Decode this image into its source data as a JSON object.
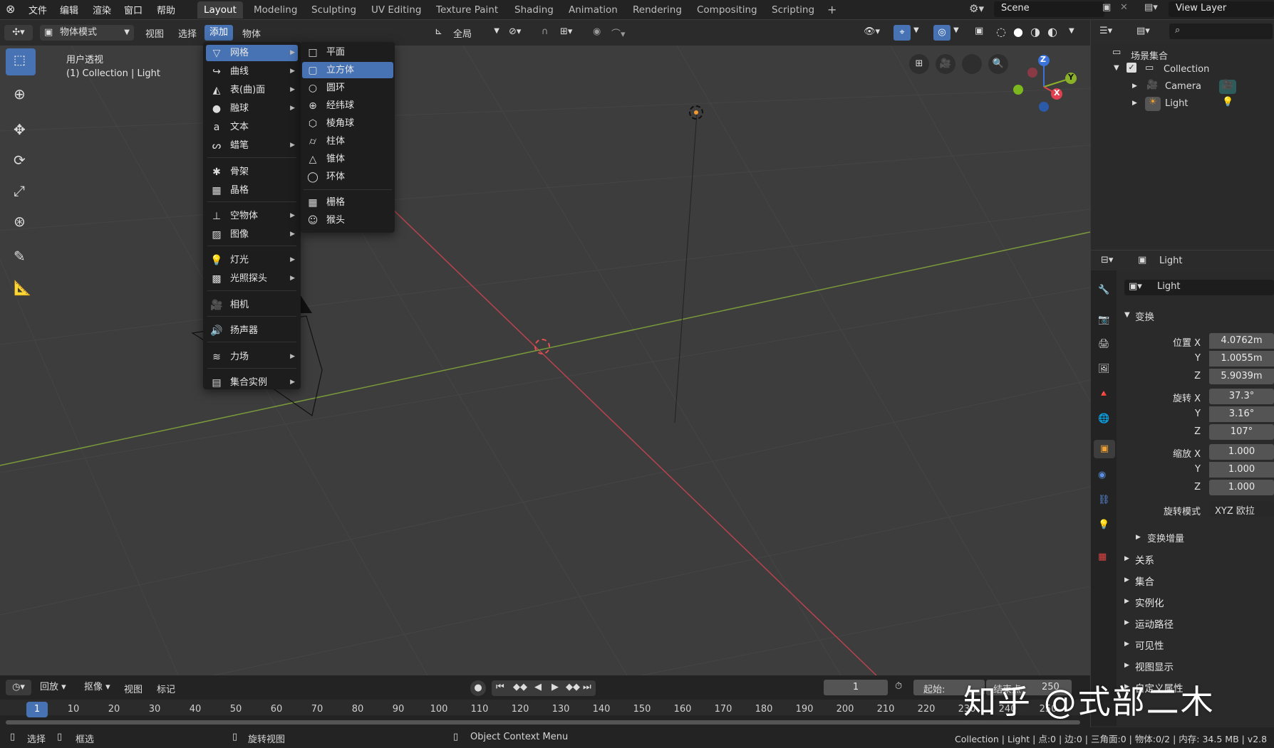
{
  "topbar": {
    "menus": [
      "文件",
      "编辑",
      "渲染",
      "窗口",
      "帮助"
    ],
    "workspaces": [
      "Layout",
      "Modeling",
      "Sculpting",
      "UV Editing",
      "Texture Paint",
      "Shading",
      "Animation",
      "Rendering",
      "Compositing",
      "Scripting"
    ],
    "active_workspace": "Layout",
    "add_tab": "+",
    "scene": "Scene",
    "view_layer": "View Layer"
  },
  "viewport_header": {
    "mode": "物体模式",
    "menus": [
      "视图",
      "选择",
      "添加",
      "物体"
    ],
    "orientation": "全局"
  },
  "viewport": {
    "view_name": "用户透视",
    "context": "(1) Collection | Light",
    "gizmo": {
      "z": "Z",
      "y": "Y",
      "x": "X"
    }
  },
  "add_menu": {
    "items": [
      {
        "icon": "mesh-icon",
        "label": "网格",
        "submenu": true
      },
      {
        "icon": "curve-icon",
        "label": "曲线",
        "submenu": true
      },
      {
        "icon": "surface-icon",
        "label": "表(曲)面",
        "submenu": true
      },
      {
        "icon": "metaball-icon",
        "label": "融球",
        "submenu": true
      },
      {
        "icon": "text-icon",
        "label": "文本",
        "submenu": false
      },
      {
        "icon": "grease-pencil-icon",
        "label": "蜡笔",
        "submenu": true
      },
      {
        "icon": "armature-icon",
        "label": "骨架",
        "submenu": false
      },
      {
        "icon": "lattice-icon",
        "label": "晶格",
        "submenu": false
      },
      {
        "icon": "empty-icon",
        "label": "空物体",
        "submenu": true
      },
      {
        "icon": "image-icon",
        "label": "图像",
        "submenu": true
      },
      {
        "icon": "light-icon",
        "label": "灯光",
        "submenu": true
      },
      {
        "icon": "light-probe-icon",
        "label": "光照探头",
        "submenu": true
      },
      {
        "icon": "camera-icon",
        "label": "相机",
        "submenu": false
      },
      {
        "icon": "speaker-icon",
        "label": "扬声器",
        "submenu": false
      },
      {
        "icon": "force-field-icon",
        "label": "力场",
        "submenu": true
      },
      {
        "icon": "collection-instance-icon",
        "label": "集合实例",
        "submenu": true
      }
    ],
    "active_index": 0
  },
  "mesh_submenu": {
    "items": [
      "平面",
      "立方体",
      "圆环",
      "经纬球",
      "棱角球",
      "柱体",
      "锥体",
      "环体",
      "栅格",
      "猴头"
    ],
    "highlight_index": 1
  },
  "outliner": {
    "root": "场景集合",
    "collection": "Collection",
    "children": [
      "Camera",
      "Light"
    ]
  },
  "properties": {
    "object_name": "Light",
    "object_field": "Light",
    "section_transform": "变换",
    "location_label": "位置 X",
    "y_label": "Y",
    "z_label": "Z",
    "location": [
      "4.0762m",
      "1.0055m",
      "5.9039m"
    ],
    "rotation_label": "旋转 X",
    "rotation": [
      "37.3°",
      "3.16°",
      "107°"
    ],
    "scale_label": "缩放 X",
    "scale": [
      "1.000",
      "1.000",
      "1.000"
    ],
    "rotation_mode_label": "旋转模式",
    "rotation_mode": "XYZ 欧拉",
    "delta": "变换增量",
    "sections": [
      "关系",
      "集合",
      "实例化",
      "运动路径",
      "可见性",
      "视图显示",
      "自定义属性"
    ]
  },
  "timeline": {
    "menus": [
      "回放",
      "抠像",
      "视图",
      "标记"
    ],
    "current_frame": "1",
    "start_label": "起始:",
    "end_label": "结束点",
    "end_value": "250",
    "ticks": [
      "1",
      "10",
      "20",
      "30",
      "40",
      "50",
      "60",
      "70",
      "80",
      "90",
      "100",
      "110",
      "120",
      "130",
      "140",
      "150",
      "160",
      "170",
      "180",
      "190",
      "200",
      "210",
      "220",
      "230",
      "240",
      "250"
    ]
  },
  "statusbar": {
    "select": "选择",
    "box_select": "框选",
    "rotate_view": "旋转视图",
    "context_menu": "Object Context Menu",
    "stats": "Collection | Light | 点:0 | 边:0 | 三角面:0 | 物体:0/2 | 内存: 34.5 MB | v2.8"
  },
  "watermark": "知乎 @式部二木"
}
